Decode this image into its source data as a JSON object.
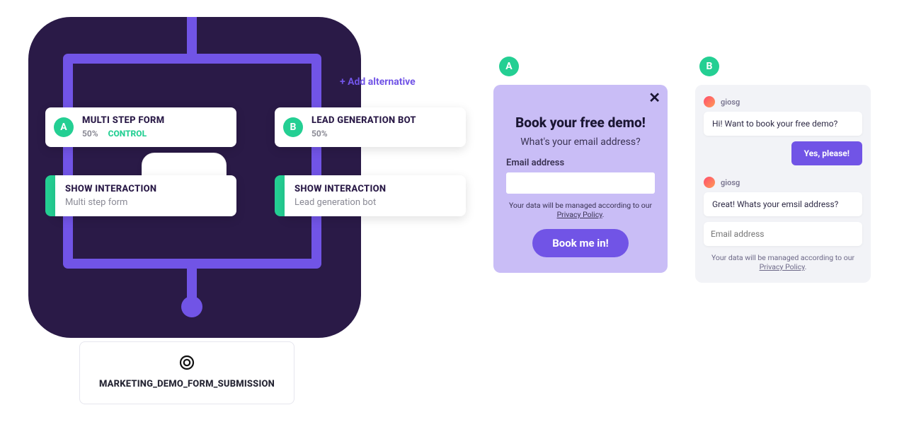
{
  "flow": {
    "add_alternative_label": "+ Add alternative",
    "variants": {
      "a": {
        "badge": "A",
        "title": "MULTI STEP FORM",
        "percent": "50%",
        "control_label": "CONTROL"
      },
      "b": {
        "badge": "B",
        "title": "LEAD GENERATION BOT",
        "percent": "50%"
      }
    },
    "show_interaction_label": "SHOW INTERACTION",
    "interaction_value": {
      "a": "Multi step form",
      "b": "Lead generation bot"
    },
    "goal_event": "MARKETING_DEMO_FORM_SUBMISSION"
  },
  "preview_badges": {
    "a": "A",
    "b": "B"
  },
  "modalA": {
    "heading": "Book your free demo!",
    "question": "What's your email address?",
    "field_label": "Email address",
    "policy_prefix": "Your data will be managed according to our ",
    "policy_link_text": "Privacy Policy",
    "cta": "Book me in!"
  },
  "chatB": {
    "bot_name": "giosg",
    "msg1": "Hi! Want to book your free demo?",
    "reply1": "Yes, please!",
    "msg2": "Great! Whats your emsil address?",
    "email_placeholder": "Email address",
    "policy_prefix": "Your data will be managed according to our ",
    "policy_link_text": "Privacy Policy"
  }
}
